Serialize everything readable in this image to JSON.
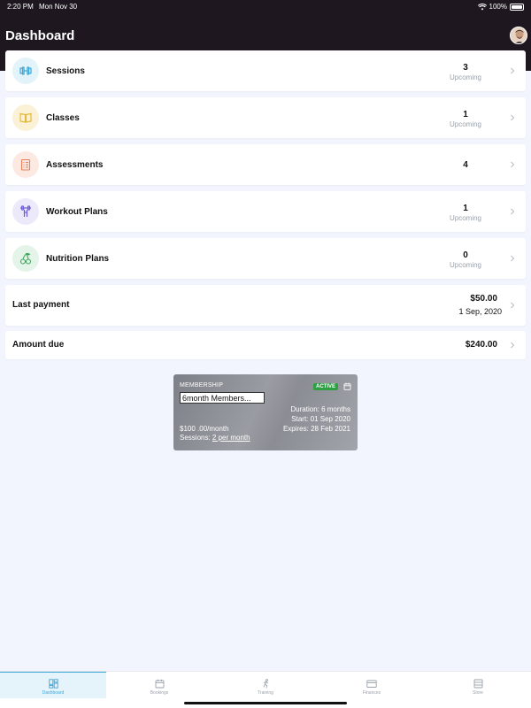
{
  "status_bar": {
    "time": "2:20 PM",
    "date": "Mon Nov 30",
    "battery": "100%"
  },
  "header": {
    "title": "Dashboard"
  },
  "rows": [
    {
      "label": "Sessions",
      "count": "3",
      "sub": "Upcoming",
      "icon": "dumbbell-icon",
      "icon_color": "#3aa6d8",
      "icon_bg": "#e3f3fa"
    },
    {
      "label": "Classes",
      "count": "1",
      "sub": "Upcoming",
      "icon": "book-icon",
      "icon_color": "#e6b93a",
      "icon_bg": "#fbf1d6"
    },
    {
      "label": "Assessments",
      "count": "4",
      "sub": "",
      "icon": "clipboard-icon",
      "icon_color": "#e8805a",
      "icon_bg": "#fce9e2"
    },
    {
      "label": "Workout Plans",
      "count": "1",
      "sub": "Upcoming",
      "icon": "barbell-icon",
      "icon_color": "#6a5bd8",
      "icon_bg": "#ece9fb"
    },
    {
      "label": "Nutrition Plans",
      "count": "0",
      "sub": "Upcoming",
      "icon": "cherries-icon",
      "icon_color": "#3aa65a",
      "icon_bg": "#e4f4e8"
    }
  ],
  "last_payment": {
    "label": "Last payment",
    "amount": "$50.00",
    "date": "1 Sep, 2020"
  },
  "amount_due": {
    "label": "Amount due",
    "amount": "$240.00"
  },
  "membership": {
    "label": "MEMBERSHIP",
    "name": "6month Members...",
    "status": "ACTIVE",
    "duration": "Duration: 6 months",
    "start": "Start: 01 Sep 2020",
    "expires": "Expires: 28 Feb 2021",
    "price": "$100 .00/month",
    "sessions_prefix": "Sessions: ",
    "sessions_link": "2 per month"
  },
  "tabs": [
    {
      "label": "Dashboard",
      "active": true
    },
    {
      "label": "Bookings",
      "active": false
    },
    {
      "label": "Training",
      "active": false
    },
    {
      "label": "Finances",
      "active": false
    },
    {
      "label": "Store",
      "active": false
    }
  ],
  "colors": {
    "header_bg": "#1e1720",
    "page_bg": "#f2f5fd",
    "accent": "#3aa6d8",
    "active_badge": "#2ea043"
  }
}
